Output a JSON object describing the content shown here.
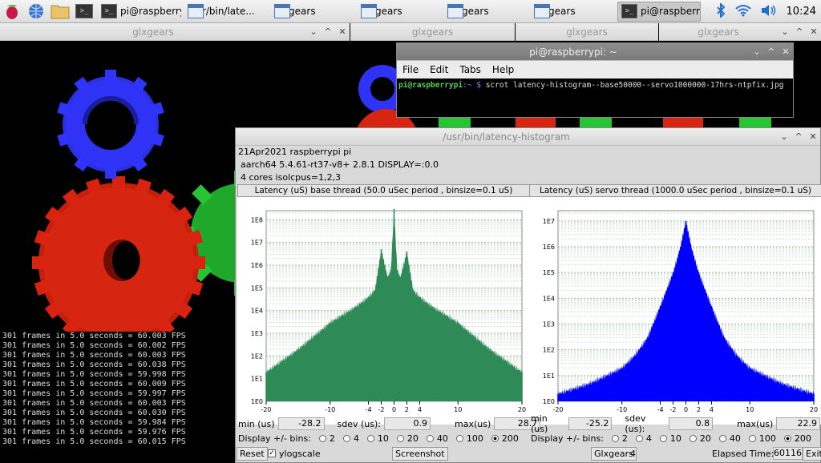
{
  "taskbar": {
    "tasks": [
      {
        "label": "pi@raspberry...",
        "icon": "terminal-icon"
      },
      {
        "label": "/usr/bin/late...",
        "icon": "window-icon"
      },
      {
        "label": "glxgears",
        "icon": "window-icon"
      },
      {
        "label": "glxgears",
        "icon": "window-icon"
      },
      {
        "label": "glxgears",
        "icon": "window-icon"
      },
      {
        "label": "glxgears",
        "icon": "window-icon"
      },
      {
        "label": "pi@raspberry...",
        "icon": "terminal-icon"
      }
    ],
    "clock": "10:24"
  },
  "gears": {
    "titles": [
      "glxgears",
      "glxgears",
      "glxgears",
      "glxgears",
      "glxgears"
    ],
    "fps_lines": [
      "301 frames in 5.0 seconds = 60.003 FPS",
      "301 frames in 5.0 seconds = 60.002 FPS",
      "301 frames in 5.0 seconds = 60.003 FPS",
      "301 frames in 5.0 seconds = 60.038 FPS",
      "301 frames in 5.0 seconds = 59.998 FPS",
      "301 frames in 5.0 seconds = 60.009 FPS",
      "301 frames in 5.0 seconds = 59.997 FPS",
      "301 frames in 5.0 seconds = 60.003 FPS",
      "301 frames in 5.0 seconds = 60.030 FPS",
      "301 frames in 5.0 seconds = 59.984 FPS",
      "301 frames in 5.0 seconds = 59.976 FPS",
      "301 frames in 5.0 seconds = 60.015 FPS"
    ]
  },
  "terminal": {
    "title": "pi@raspberrypi: ~",
    "menu": [
      "File",
      "Edit",
      "Tabs",
      "Help"
    ],
    "prompt_user": "pi@raspberrypi",
    "prompt_dir": ":~ $",
    "command": " scrot latency-histogram--base50000--servo1000000-17hrs-ntpfix.jpg"
  },
  "histogram": {
    "title": "/usr/bin/latency-histogram",
    "info": [
      "21Apr2021 raspberrypi pi",
      "aarch64  5.4.61-rt37-v8+  2.8.1  DISPLAY=:0.0",
      "4 cores  isolcpus=1,2,3"
    ],
    "base": {
      "title": "Latency (uS) base thread (50.0 uSec period , binsize=0.1 uS)",
      "min_label": "min (us)",
      "min": "-28.2",
      "sdev_label": "sdev (us):",
      "sdev": "0.9",
      "max_label": "max(us)",
      "max": "28.7"
    },
    "servo": {
      "title": "Latency (uS) servo thread (1000.0 uSec period , binsize=0.1 uS)",
      "min_label": "min (us)",
      "min": "-25.2",
      "sdev_label": "sdev (us):",
      "sdev": "0.8",
      "max_label": "max(us)",
      "max": "22.9"
    },
    "bins_label": "Display +/- bins:",
    "bins": [
      "2",
      "4",
      "10",
      "20",
      "40",
      "100",
      "200"
    ],
    "bins_selected": "200",
    "reset": "Reset",
    "ylog": "ylogscale",
    "screenshot": "Screenshot",
    "glxgears": "Glxgears",
    "glxgears_count": "4",
    "elapsed_label": "Elapsed Time:",
    "elapsed": "60116",
    "exit": "Exit"
  },
  "chart_data": [
    {
      "type": "bar",
      "title": "Latency (uS) base thread (50.0 uSec period , binsize=0.1 uS)",
      "color": "#2e8b57",
      "log_y": true,
      "xlim": [
        -20,
        20
      ],
      "x_ticks": [
        -20,
        -10,
        -4,
        -2,
        0,
        2,
        4,
        10,
        20
      ],
      "y_ticks": [
        "1E0",
        "1E1",
        "1E2",
        "1E3",
        "1E4",
        "1E5",
        "1E6",
        "1E7",
        "1E8"
      ],
      "x": [
        -20,
        -15,
        -10,
        -6,
        -4,
        -3,
        -2,
        -1,
        -0.5,
        0,
        0.5,
        1,
        2,
        3,
        4,
        6,
        10,
        15,
        20
      ],
      "values": [
        20,
        200,
        3000,
        15000,
        40000,
        80000,
        5000000,
        300000,
        600000,
        300000000,
        600000,
        300000,
        4000000,
        80000,
        40000,
        15000,
        3000,
        200,
        20
      ]
    },
    {
      "type": "bar",
      "title": "Latency (uS) servo thread (1000.0 uSec period , binsize=0.1 uS)",
      "color": "#0000ff",
      "log_y": true,
      "xlim": [
        -20,
        20
      ],
      "x_ticks": [
        -20,
        -10,
        -4,
        -2,
        0,
        2,
        4,
        10,
        20
      ],
      "y_ticks": [
        "1E0",
        "1E1",
        "1E2",
        "1E3",
        "1E4",
        "1E5",
        "1E6",
        "1E7"
      ],
      "x": [
        -20,
        -15,
        -10,
        -8,
        -6,
        -4,
        -2,
        -1,
        0,
        1,
        2,
        4,
        6,
        8,
        10,
        15,
        20
      ],
      "values": [
        2,
        5,
        20,
        60,
        300,
        5000,
        100000,
        700000,
        10000000,
        700000,
        100000,
        5000,
        300,
        60,
        20,
        5,
        2
      ]
    }
  ]
}
